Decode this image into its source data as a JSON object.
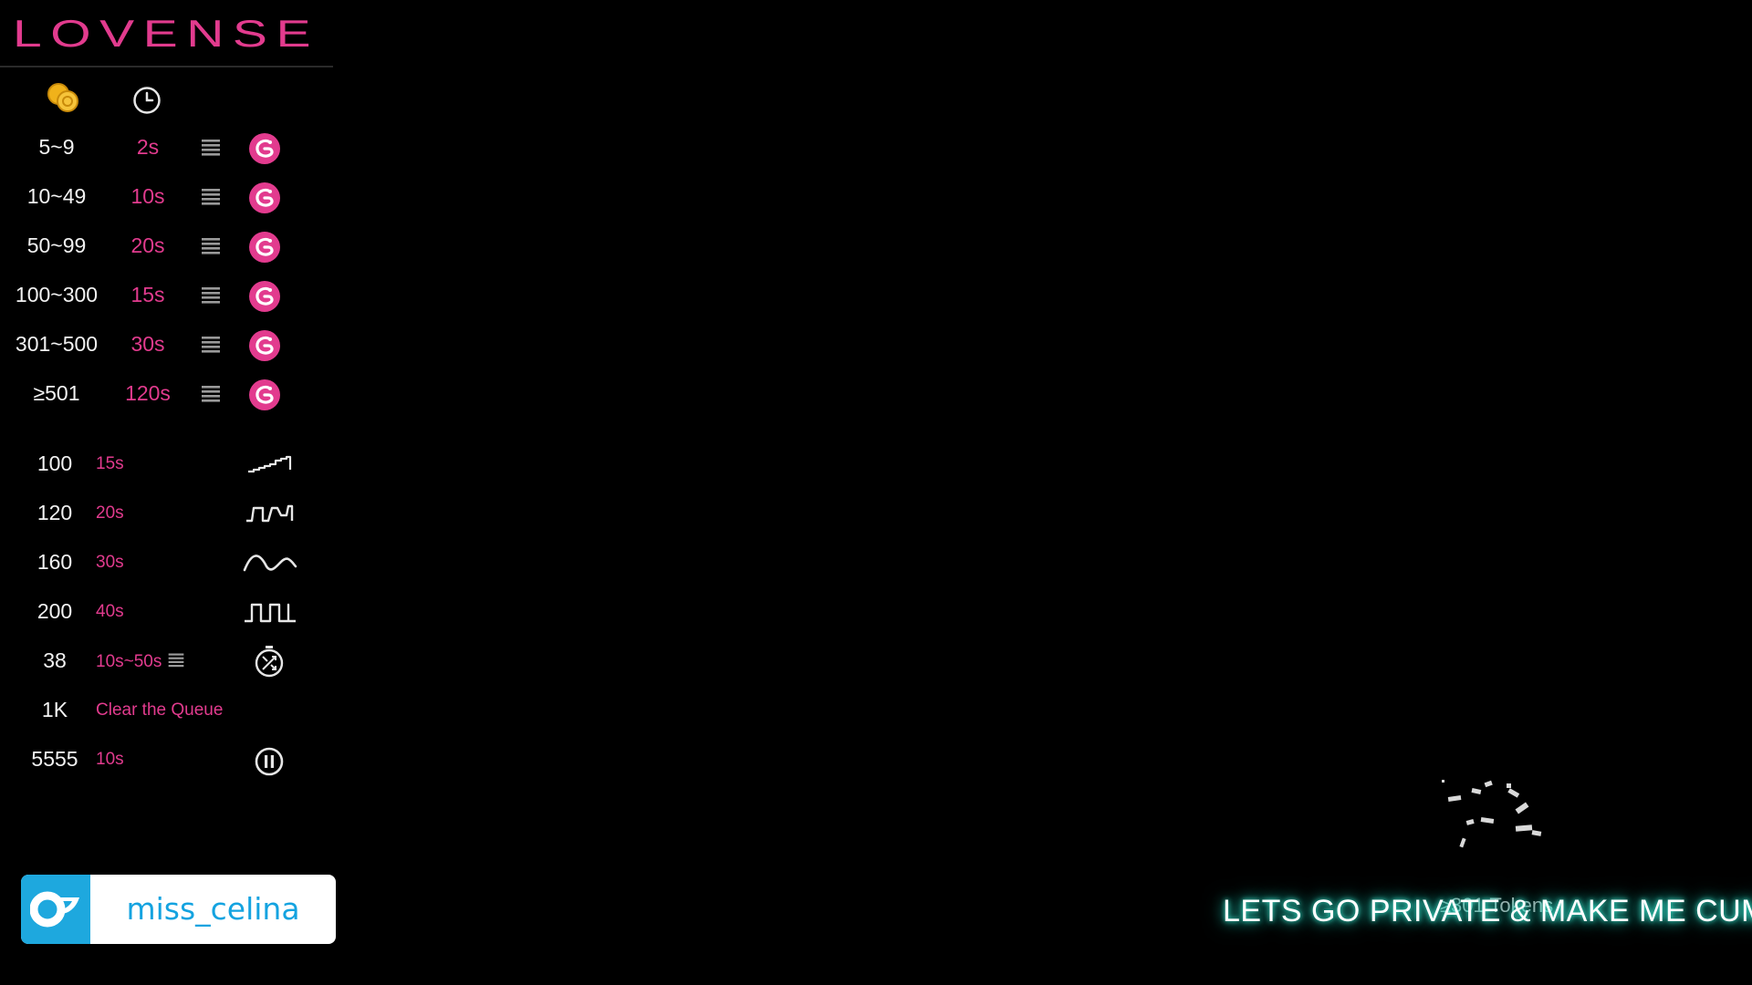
{
  "brand": {
    "logo_text": "LOVENSE",
    "accent": "#e23b8e"
  },
  "header_icons": [
    "coins-icon",
    "clock-icon"
  ],
  "levels": [
    {
      "range": "5~9",
      "duration": "2s"
    },
    {
      "range": "10~49",
      "duration": "10s"
    },
    {
      "range": "50~99",
      "duration": "20s"
    },
    {
      "range": "100~300",
      "duration": "15s"
    },
    {
      "range": "301~500",
      "duration": "30s"
    },
    {
      "range": "≥501",
      "duration": "120s"
    }
  ],
  "special_commands": [
    {
      "amount": "100",
      "duration": "15s",
      "icon": "pattern-wave-icon"
    },
    {
      "amount": "120",
      "duration": "20s",
      "icon": "pattern-pulse-icon"
    },
    {
      "amount": "160",
      "duration": "30s",
      "icon": "pattern-earthquake-icon"
    },
    {
      "amount": "200",
      "duration": "40s",
      "icon": "pattern-fireworks-icon"
    },
    {
      "amount": "38",
      "duration": "10s~50s",
      "icon": "random-time-icon"
    },
    {
      "amount": "1K",
      "duration": "Clear the Queue",
      "icon": ""
    },
    {
      "amount": "5555",
      "duration": "10s",
      "icon": "pause-icon"
    }
  ],
  "onlyfans": {
    "username": "miss_celina",
    "color": "#1ea8de"
  },
  "overlay": {
    "tokens_label": "≥301 Tokens",
    "goal_text": "LETS GO PRIVATE & MAKE ME CUM!",
    "glow_color": "#2bd8c2"
  }
}
